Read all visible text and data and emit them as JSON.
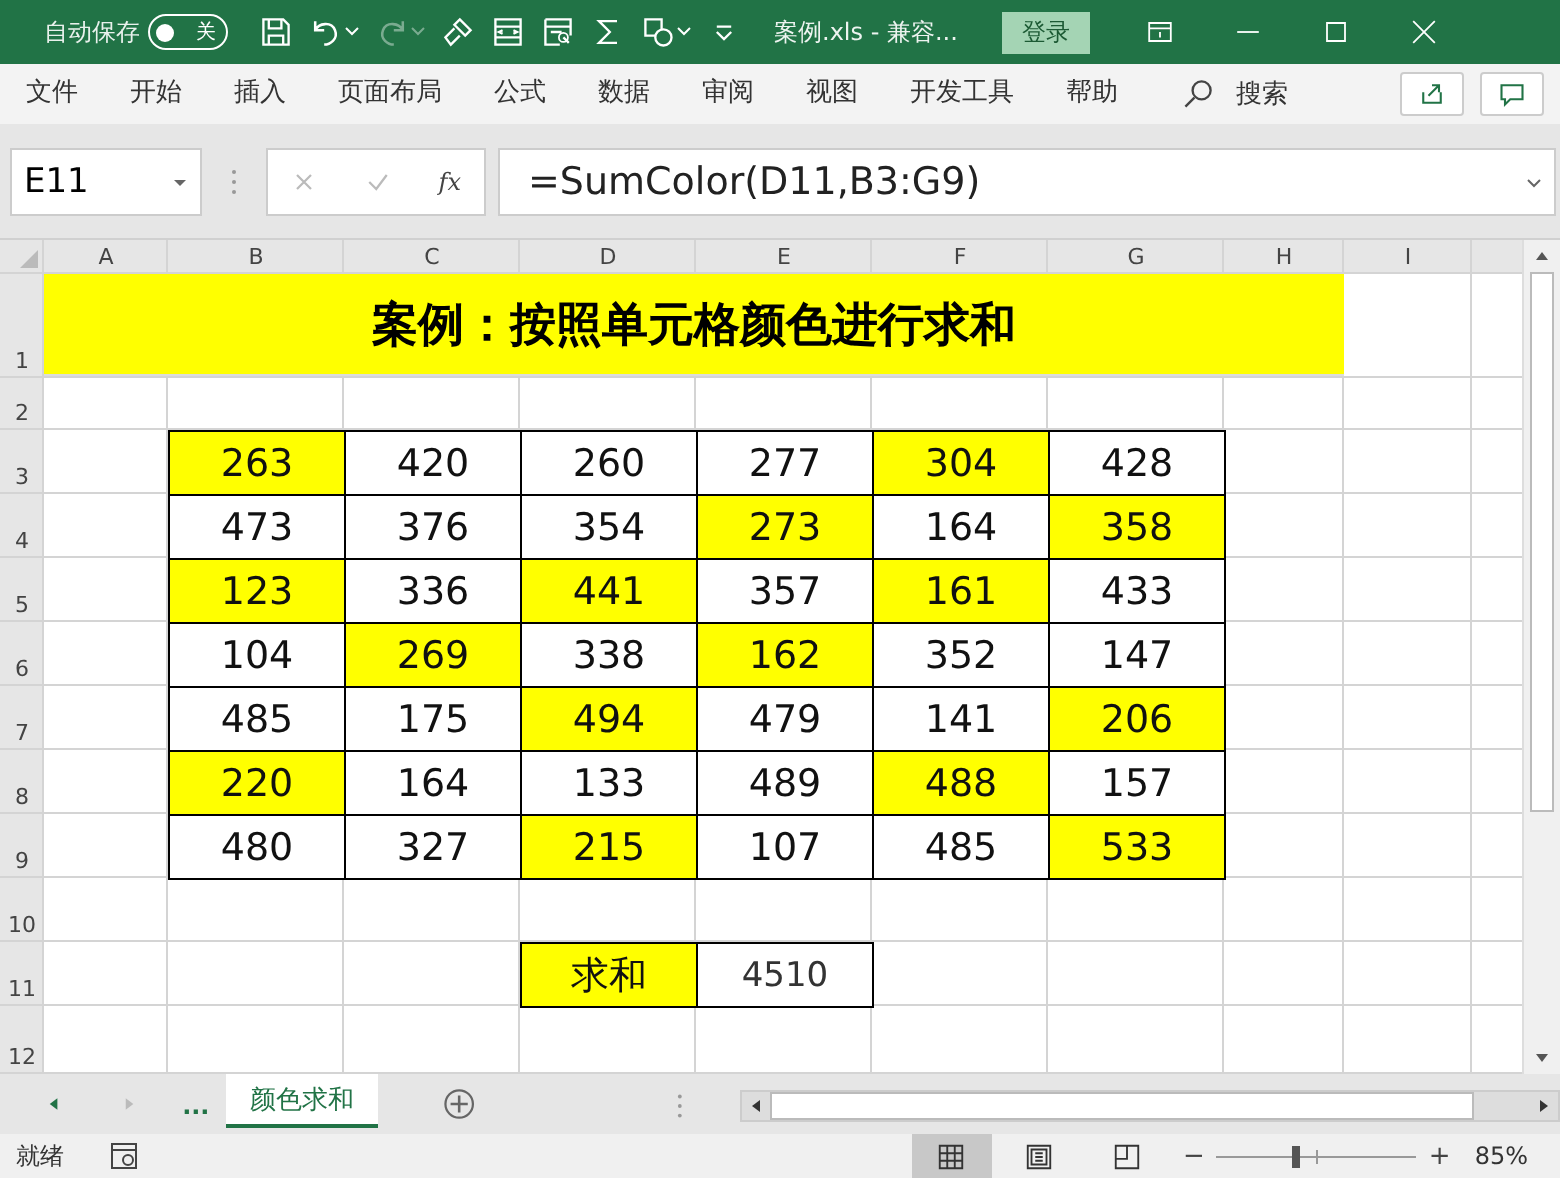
{
  "title_bar": {
    "autosave_label": "自动保存",
    "autosave_toggle": {
      "on": false,
      "label": "关"
    },
    "document_title": "案例.xls  -  兼容...",
    "login_button": "登录"
  },
  "ribbon_tabs": [
    {
      "label": "文件",
      "selected": false
    },
    {
      "label": "开始",
      "selected": false
    },
    {
      "label": "插入",
      "selected": false
    },
    {
      "label": "页面布局",
      "selected": false
    },
    {
      "label": "公式",
      "selected": false
    },
    {
      "label": "数据",
      "selected": false
    },
    {
      "label": "审阅",
      "selected": false
    },
    {
      "label": "视图",
      "selected": false
    },
    {
      "label": "开发工具",
      "selected": false
    },
    {
      "label": "帮助",
      "selected": false
    }
  ],
  "search_label": "搜索",
  "formula_bar": {
    "name_box": "E11",
    "fx": "fx",
    "formula": "=SumColor(D11,B3:G9)"
  },
  "sheet": {
    "columns": [
      "A",
      "B",
      "C",
      "D",
      "E",
      "F",
      "G",
      "H",
      "I"
    ],
    "row_numbers": [
      "1",
      "2",
      "3",
      "4",
      "5",
      "6",
      "7",
      "8",
      "9",
      "10",
      "11",
      "12"
    ],
    "title": "案例：按照单元格颜色进行求和",
    "data_rows": [
      [
        {
          "value": "263",
          "highlighted": true
        },
        {
          "value": "420",
          "highlighted": false
        },
        {
          "value": "260",
          "highlighted": false
        },
        {
          "value": "277",
          "highlighted": false
        },
        {
          "value": "304",
          "highlighted": true
        },
        {
          "value": "428",
          "highlighted": false
        }
      ],
      [
        {
          "value": "473",
          "highlighted": false
        },
        {
          "value": "376",
          "highlighted": false
        },
        {
          "value": "354",
          "highlighted": false
        },
        {
          "value": "273",
          "highlighted": true
        },
        {
          "value": "164",
          "highlighted": false
        },
        {
          "value": "358",
          "highlighted": true
        }
      ],
      [
        {
          "value": "123",
          "highlighted": true
        },
        {
          "value": "336",
          "highlighted": false
        },
        {
          "value": "441",
          "highlighted": true
        },
        {
          "value": "357",
          "highlighted": false
        },
        {
          "value": "161",
          "highlighted": true
        },
        {
          "value": "433",
          "highlighted": false
        }
      ],
      [
        {
          "value": "104",
          "highlighted": false
        },
        {
          "value": "269",
          "highlighted": true
        },
        {
          "value": "338",
          "highlighted": false
        },
        {
          "value": "162",
          "highlighted": true
        },
        {
          "value": "352",
          "highlighted": false
        },
        {
          "value": "147",
          "highlighted": false
        }
      ],
      [
        {
          "value": "485",
          "highlighted": false
        },
        {
          "value": "175",
          "highlighted": false
        },
        {
          "value": "494",
          "highlighted": true
        },
        {
          "value": "479",
          "highlighted": false
        },
        {
          "value": "141",
          "highlighted": false
        },
        {
          "value": "206",
          "highlighted": true
        }
      ],
      [
        {
          "value": "220",
          "highlighted": true
        },
        {
          "value": "164",
          "highlighted": false
        },
        {
          "value": "133",
          "highlighted": false
        },
        {
          "value": "489",
          "highlighted": false
        },
        {
          "value": "488",
          "highlighted": true
        },
        {
          "value": "157",
          "highlighted": false
        }
      ],
      [
        {
          "value": "480",
          "highlighted": false
        },
        {
          "value": "327",
          "highlighted": false
        },
        {
          "value": "215",
          "highlighted": true
        },
        {
          "value": "107",
          "highlighted": false
        },
        {
          "value": "485",
          "highlighted": false
        },
        {
          "value": "533",
          "highlighted": true
        }
      ]
    ],
    "sum_label": {
      "value": "求和",
      "highlighted": true
    },
    "sum_value": {
      "value": "4510",
      "highlighted": false
    }
  },
  "sheet_tabs": {
    "more": "...",
    "tabs": [
      {
        "label": "颜色求和",
        "selected": true
      }
    ]
  },
  "status_bar": {
    "status": "就绪",
    "views": [
      {
        "kind": "normal",
        "selected": true
      },
      {
        "kind": "layout",
        "selected": false
      },
      {
        "kind": "pagebreak",
        "selected": false
      }
    ],
    "zoom_minus": "−",
    "zoom_plus": "+",
    "zoom_slider": {
      "level": 0.4
    },
    "zoom": "85%"
  }
}
